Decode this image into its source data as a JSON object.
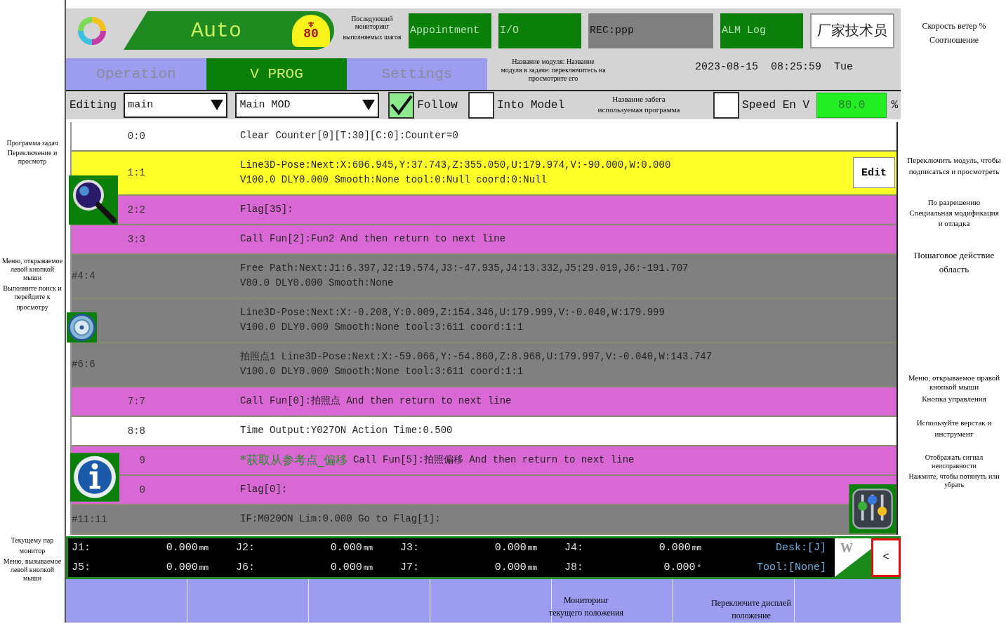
{
  "header": {
    "mode": "Auto",
    "speed": "80",
    "buttons": [
      {
        "label": "Appointment",
        "kind": "menu"
      },
      {
        "label": "I/O",
        "kind": "menu"
      },
      {
        "label": "REC:ppp",
        "kind": "status"
      },
      {
        "label": "ALM Log",
        "kind": "menu"
      }
    ],
    "user": "厂家技术员"
  },
  "datetime": {
    "date": "2023-08-15",
    "time": "08:25:59",
    "weekday": "Tue"
  },
  "tabs": [
    {
      "label": "Operation",
      "selected": false
    },
    {
      "label": "V PROG",
      "selected": true
    },
    {
      "label": "Settings",
      "selected": false
    }
  ],
  "toolbar": {
    "editing_label": "Editing",
    "task": "main",
    "module": "Main MOD",
    "follow": {
      "label": "Follow",
      "checked": true
    },
    "into_model": {
      "label": "Into Model",
      "checked": false
    },
    "speed_enable": {
      "label": "Speed En V",
      "checked": false
    },
    "speed": "80.0",
    "speed_unit": "%"
  },
  "program": {
    "edit_button": "Edit",
    "rows": [
      {
        "number": "0:0",
        "kind": "basic",
        "selected": false,
        "lines": [
          "Clear Counter[0][T:30][C:0]:Counter=0"
        ]
      },
      {
        "number": "1:1",
        "kind": "motion",
        "selected": true,
        "lines": [
          "Line3D-Pose:Next:X:606.945,Y:37.743,Z:355.050,U:179.974,V:-90.000,W:0.000",
          "V100.0 DLY0.000 Smooth:None tool:0:Null coord:0:Null"
        ]
      },
      {
        "number": "2:2",
        "kind": "logic",
        "selected": false,
        "lines": [
          "Flag[35]:"
        ]
      },
      {
        "number": "3:3",
        "kind": "logic",
        "selected": false,
        "lines": [
          "Call Fun[2]:Fun2 And then return to next line"
        ]
      },
      {
        "number": "#4:4",
        "kind": "motion",
        "selected": false,
        "lines": [
          "Free Path:Next:J1:6.397,J2:19.574,J3:-47.935,J4:13.332,J5:29.019,J6:-191.707",
          "V80.0 DLY0.000 Smooth:None"
        ]
      },
      {
        "kind": "motion",
        "selected": false,
        "lines": [
          "Line3D-Pose:Next:X:-0.208,Y:0.009,Z:154.346,U:179.999,V:-0.040,W:179.999",
          "V100.0 DLY0.000 Smooth:None tool:3:611 coord:1:1"
        ]
      },
      {
        "number": "#6:6",
        "kind": "motion",
        "selected": false,
        "lines": [
          "拍照点1 Line3D-Pose:Next:X:-59.066,Y:-54.860,Z:8.968,U:179.997,V:-0.040,W:143.747",
          "V100.0 DLY0.000 Smooth:None tool:3:611 coord:1:1"
        ]
      },
      {
        "number": "7:7",
        "kind": "logic",
        "selected": false,
        "lines": [
          "Call Fun[0]:拍照点 And then return to next line"
        ]
      },
      {
        "number": "8:8",
        "kind": "basic",
        "selected": false,
        "lines": [
          "Time Output:Y027ON Action Time:0.500"
        ]
      },
      {
        "number": "9",
        "kind": "logic",
        "selected": false,
        "comment": "*获取从参考点_偏移",
        "lines": [
          "Call Fun[5]:拍照偏移 And then return to next line"
        ]
      },
      {
        "number": "0",
        "kind": "logic",
        "selected": false,
        "lines": [
          "Flag[0]:"
        ]
      },
      {
        "number": "#11:11",
        "kind": "motion",
        "selected": false,
        "lines": [
          "IF:M020ON Lim:0.000 Go to Flag[1]:"
        ]
      }
    ]
  },
  "status": {
    "axes": [
      {
        "name": "J1:",
        "value": "0.000",
        "unit": "mm"
      },
      {
        "name": "J2:",
        "value": "0.000",
        "unit": "mm"
      },
      {
        "name": "J3:",
        "value": "0.000",
        "unit": "mm"
      },
      {
        "name": "J4:",
        "value": "0.000",
        "unit": "mm"
      },
      {
        "name": "J5:",
        "value": "0.000",
        "unit": "mm"
      },
      {
        "name": "J6:",
        "value": "0.000",
        "unit": "mm"
      },
      {
        "name": "J7:",
        "value": "0.000",
        "unit": "mm"
      },
      {
        "name": "J8:",
        "value": "0.000",
        "unit": "°"
      }
    ],
    "desk": "Desk:[J]",
    "tool": "Tool:[None]",
    "coord_button": "W",
    "collapse_button": "<"
  },
  "notes": [
    {
      "lines": [
        "Последующий мониторинг",
        "выполняемых шагов"
      ]
    },
    {
      "lines": [
        "Скорость ветер %",
        "Соотношение"
      ]
    },
    {
      "lines": [
        "Название модуля: Название",
        "модуля в задаче: переключитесь на",
        "просмотрите его"
      ]
    },
    {
      "lines": [
        "Название забега",
        "используемая программа"
      ]
    },
    {
      "lines": [
        "Программа задач",
        "Переключение и просмотр"
      ]
    },
    {
      "lines": [
        "Переключить модуль, чтобы",
        "подписаться и просмотреть"
      ]
    },
    {
      "lines": [
        "По разрешению",
        "Специальная модификация",
        "и отладка"
      ]
    },
    {
      "lines": [
        "Меню, открываемое левой кнопкой мыши",
        "Выполните поиск и перейдите к",
        "просмотру"
      ]
    },
    {
      "lines": [
        "Пошаговое действие",
        "область"
      ]
    },
    {
      "lines": [
        "Меню, открываемое правой кнопкой мыши",
        "Кнопка управления"
      ]
    },
    {
      "lines": [
        "Используйте верстак и",
        "инструмент"
      ]
    },
    {
      "lines": [
        "Отображать сигнал неисправности",
        "Нажмите, чтобы потянуть или убрать"
      ]
    },
    {
      "lines": [
        "Текущему пар",
        "монитор",
        "Меню, вызываемое левой кнопкой мыши"
      ]
    },
    {
      "lines": [
        "Мониторинг",
        "текущего положения"
      ]
    },
    {
      "lines": [
        "Переключите дисплей",
        "положение"
      ]
    }
  ]
}
